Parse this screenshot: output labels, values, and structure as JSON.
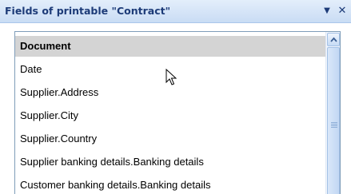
{
  "panel": {
    "title": "Fields of printable \"Contract\"",
    "dropdown_glyph": "▼",
    "close_glyph": "✕"
  },
  "fields": {
    "items": [
      {
        "label": "Document",
        "selected": true
      },
      {
        "label": "Date",
        "selected": false
      },
      {
        "label": "Supplier.Address",
        "selected": false
      },
      {
        "label": "Supplier.City",
        "selected": false
      },
      {
        "label": "Supplier.Country",
        "selected": false
      },
      {
        "label": "Supplier banking details.Banking details",
        "selected": false
      },
      {
        "label": "Customer banking details.Banking details",
        "selected": false
      }
    ]
  },
  "icons": {
    "dropdown": "chevron-down-icon",
    "close": "close-icon",
    "scroll_up": "arrow-up-icon",
    "pointer": "mouse-pointer-icon"
  },
  "colors": {
    "header_text": "#1d3b78",
    "selected_row": "#d4d4d4",
    "list_border": "#7f9db9"
  }
}
